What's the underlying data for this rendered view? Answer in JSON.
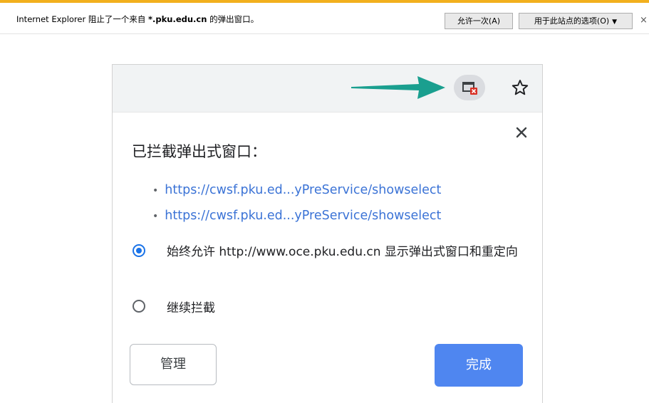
{
  "ie_bar": {
    "message_prefix": "Internet Explorer 阻止了一个来自 ",
    "message_domain": "*.pku.edu.cn",
    "message_suffix": " 的弹出窗口。",
    "allow_once_label": "允许一次(A)",
    "site_options_label": "用于此站点的选项(O)",
    "site_options_caret": "▼",
    "close_glyph": "×",
    "accent_color": "#f2b01e"
  },
  "chrome_dialog": {
    "title": "已拦截弹出式窗口：",
    "blocked_urls": [
      "https://cwsf.pku.ed...yPreService/showselect",
      "https://cwsf.pku.ed...yPreService/showselect"
    ],
    "bullet": "•",
    "option_always_allow": "始终允许 http://www.oce.pku.edu.cn 显示弹出式窗口和重定向",
    "option_keep_blocking": "继续拦截",
    "selected_option": "always_allow",
    "manage_label": "管理",
    "done_label": "完成",
    "link_color": "#3b73d6",
    "primary_button_color": "#4f86f0",
    "arrow_color": "#1a9f8f"
  }
}
